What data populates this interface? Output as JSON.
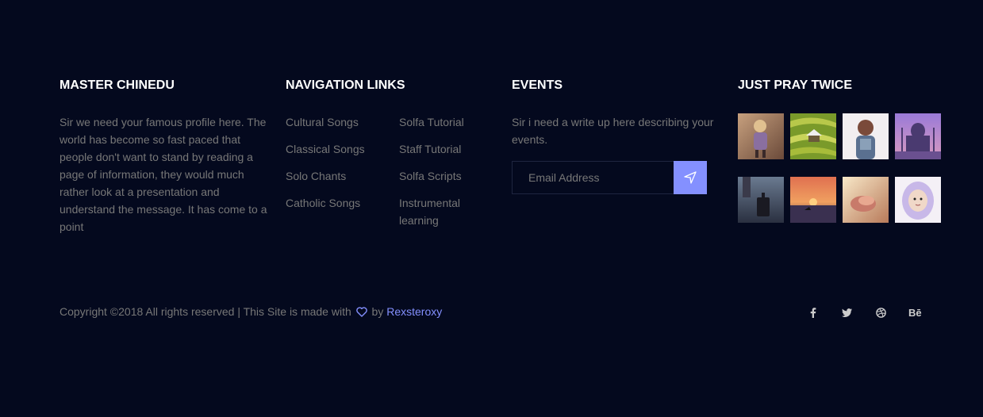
{
  "about": {
    "title": "MASTER CHINEDU",
    "text": "Sir we need your famous profile here. The world has become so fast paced that people don't want to stand by reading a page of information, they would much rather look at a presentation and understand the message. It has come to a point"
  },
  "nav": {
    "title": "NAVIGATION LINKS",
    "left": [
      "Cultural Songs",
      "Classical Songs",
      "Solo Chants",
      "Catholic Songs"
    ],
    "right": [
      "Solfa Tutorial",
      "Staff Tutorial",
      "Solfa Scripts",
      "Instrumental learning"
    ]
  },
  "events": {
    "title": "EVENTS",
    "text": "Sir i need a write up here describing your events.",
    "email_placeholder": "Email Address",
    "submit_icon": "send-icon"
  },
  "gallery": {
    "title": "JUST PRAY TWICE",
    "images": [
      "girl-walking",
      "rice-terrace-hut",
      "girl-backpack",
      "taj-mahal",
      "traveler-suitcase",
      "sunset-sea",
      "hands-sunlight",
      "child-hood"
    ]
  },
  "footer": {
    "copyright_prefix": "Copyright ©2018 All rights reserved | This Site is made with",
    "by": "by",
    "author": "Rexsteroxy",
    "heart_icon": "heart-icon",
    "accent": "#8490ff",
    "social": [
      {
        "name": "facebook-icon",
        "glyph": "f"
      },
      {
        "name": "twitter-icon",
        "glyph": "t"
      },
      {
        "name": "dribbble-icon",
        "glyph": "d"
      },
      {
        "name": "behance-icon",
        "glyph": "Bē"
      }
    ]
  }
}
